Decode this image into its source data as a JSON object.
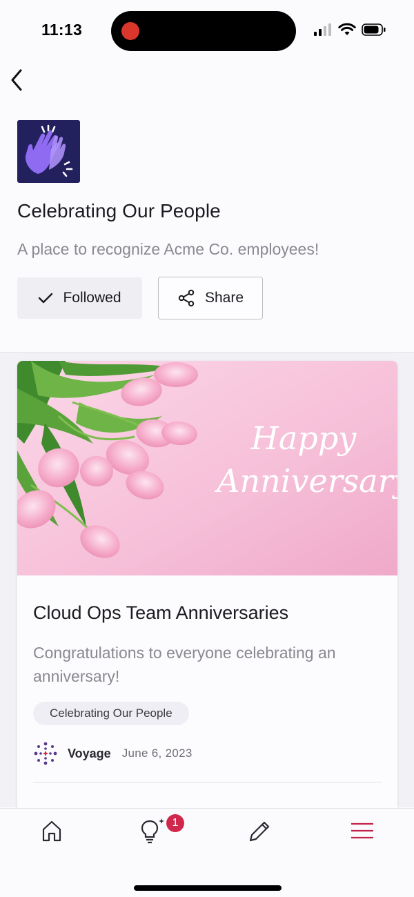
{
  "status_bar": {
    "time": "11:13"
  },
  "community": {
    "title": "Celebrating Our People",
    "description": "A place to recognize Acme Co. employees!",
    "followed_label": "Followed",
    "share_label": "Share"
  },
  "post": {
    "image_text_line1": "Happy",
    "image_text_line2": "Anniversary",
    "title": "Cloud Ops Team Anniversaries",
    "body": "Congratulations to everyone celebrating an anniversary!",
    "tag": "Celebrating Our People",
    "author": "Voyage",
    "date": "June 6, 2023"
  },
  "nav": {
    "items": [
      "home-icon",
      "ideas-icon",
      "compose-icon",
      "menu-icon"
    ],
    "ideas_badge": "1"
  },
  "colors": {
    "accent": "#c3224a",
    "badge": "#d0284c",
    "logo_bg": "#23205e",
    "logo_hands": "#8e6bf0"
  }
}
